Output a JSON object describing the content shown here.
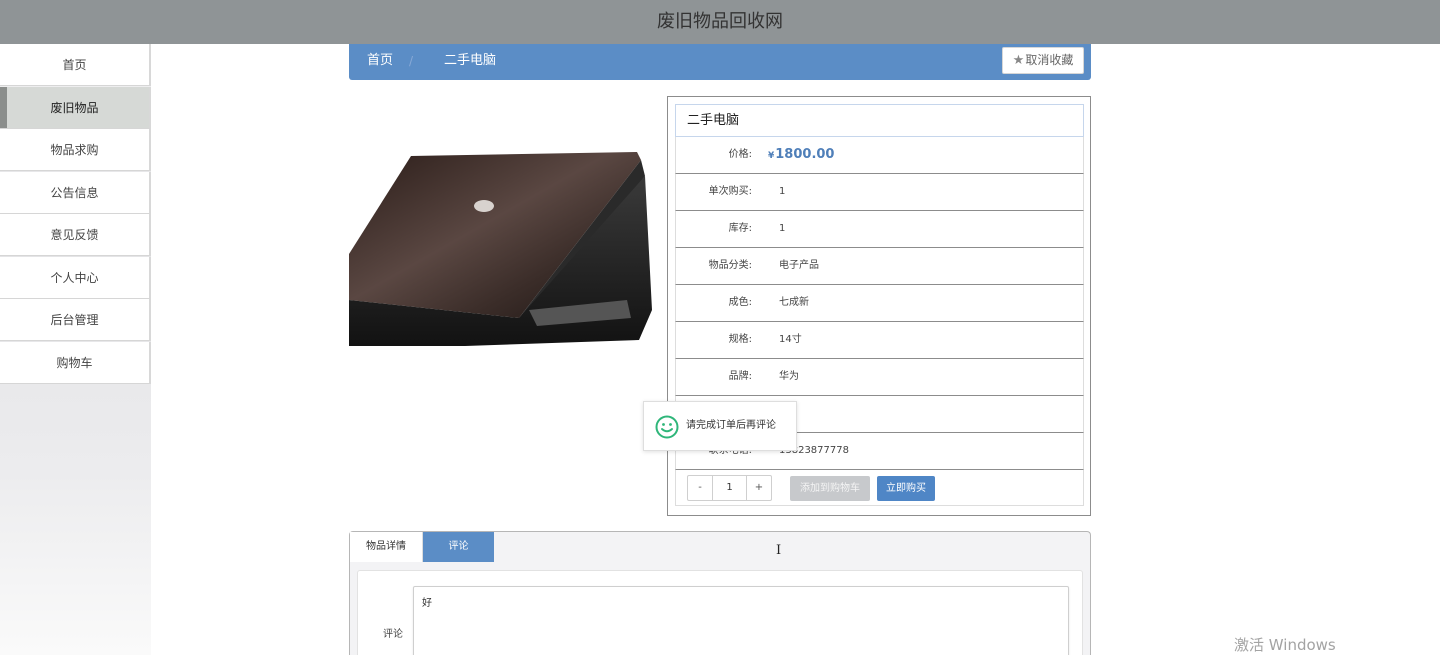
{
  "app": {
    "title": "废旧物品回收网"
  },
  "sidebar": {
    "items": [
      {
        "label": "首页",
        "active": false
      },
      {
        "label": "废旧物品",
        "active": true
      },
      {
        "label": "物品求购",
        "active": false
      },
      {
        "label": "公告信息",
        "active": false
      },
      {
        "label": "意见反馈",
        "active": false
      },
      {
        "label": "个人中心",
        "active": false
      },
      {
        "label": "后台管理",
        "active": false
      },
      {
        "label": "购物车",
        "active": false
      }
    ]
  },
  "breadcrumb": {
    "home": "首页",
    "separator": "/",
    "current": "二手电脑",
    "favorite_icon": "star-icon",
    "favorite_label": "取消收藏"
  },
  "product": {
    "image_description": "laptop-photo",
    "name": "二手电脑",
    "price_label": "价格:",
    "currency": "¥",
    "price": "1800.00",
    "rows": [
      {
        "label": "单次购买:",
        "value": "1"
      },
      {
        "label": "库存:",
        "value": "1"
      },
      {
        "label": "物品分类:",
        "value": "电子产品"
      },
      {
        "label": "成色:",
        "value": "七成新"
      },
      {
        "label": "规格:",
        "value": "14寸"
      },
      {
        "label": "品牌:",
        "value": "华为"
      },
      {
        "label": "",
        "value": ""
      },
      {
        "label": "联系电话:",
        "value": "13823877778"
      }
    ],
    "quantity": {
      "decrement": "-",
      "value": "1",
      "increment": "+"
    },
    "add_to_cart": "添加到购物车",
    "buy_now": "立即购买"
  },
  "toast": {
    "icon": "smile-icon",
    "message": "请完成订单后再评论"
  },
  "tabs": {
    "items": [
      {
        "label": "物品详情",
        "active": false
      },
      {
        "label": "评论",
        "active": true
      }
    ],
    "comment_label": "评论",
    "comment_value": "好"
  },
  "system": {
    "watermark": "激活 Windows"
  },
  "colors": {
    "accent": "#5b8dc6",
    "topbar": "#8f9496",
    "price": "#4f7fb9"
  }
}
